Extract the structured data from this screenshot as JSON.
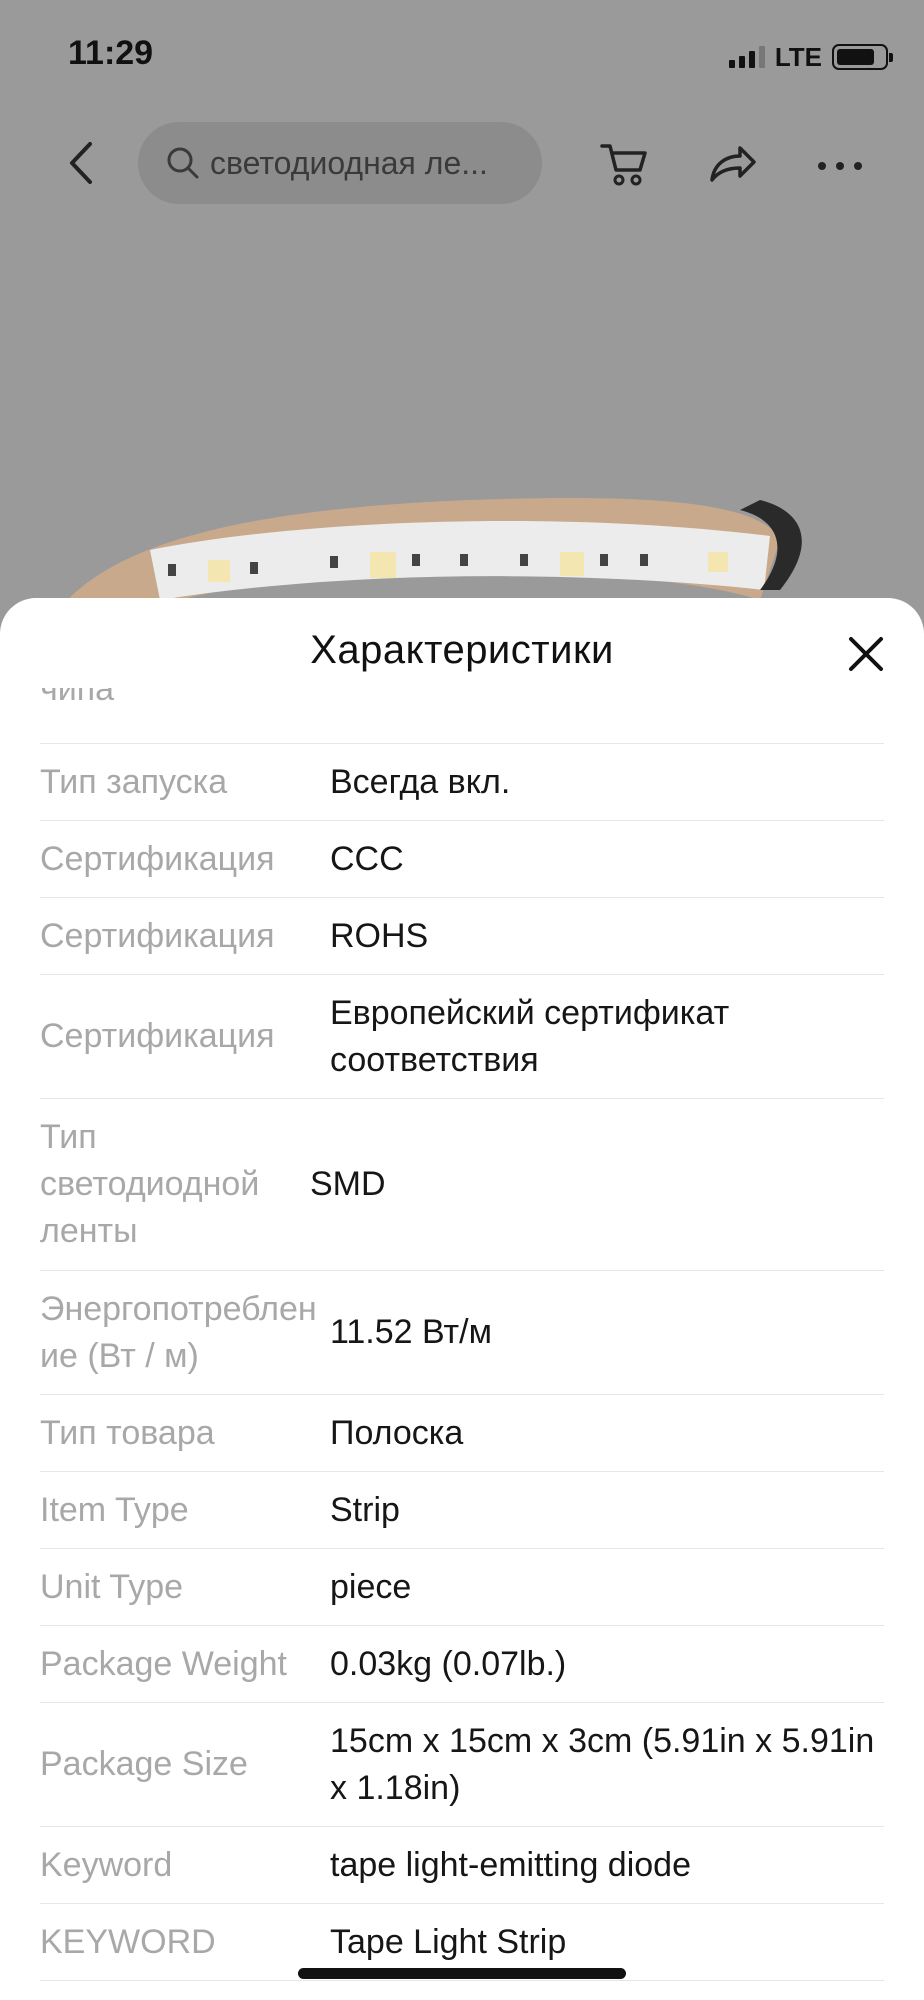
{
  "status_bar": {
    "time": "11:29",
    "network": "LTE"
  },
  "top_nav": {
    "search_text": "светодиодная ле...",
    "icons": [
      "back-icon",
      "search-icon",
      "cart-icon",
      "share-icon",
      "more-icon"
    ]
  },
  "sheet": {
    "title": "Характеристики",
    "partial_label": "чипа",
    "rows": [
      {
        "label": "Тип запуска",
        "value": "Всегда вкл."
      },
      {
        "label": "Сертификация",
        "value": "CCC"
      },
      {
        "label": "Сертификация",
        "value": "ROHS"
      },
      {
        "label": "Сертификация",
        "value": "Европейский сертификат соответствия"
      },
      {
        "label": "Тип светодиодной ленты",
        "value": "SMD"
      },
      {
        "label": "Энергопотребление (Вт / м)",
        "value": "11.52 Вт/м"
      },
      {
        "label": "Тип товара",
        "value": "Полоска"
      },
      {
        "label": "Item Type",
        "value": "Strip"
      },
      {
        "label": "Unit Type",
        "value": "piece"
      },
      {
        "label": "Package Weight",
        "value": "0.03kg (0.07lb.)"
      },
      {
        "label": "Package Size",
        "value": "15cm x 15cm x 3cm (5.91in x 5.91in x 1.18in)"
      },
      {
        "label": "Keyword",
        "value": "tape light-emitting diode"
      },
      {
        "label": "KEYWORD",
        "value": "Tape Light Strip"
      }
    ]
  },
  "colors": {
    "label": "#a8a8a8",
    "value": "#161616",
    "divider": "#e6e6e6",
    "backdrop": "#9a9a9a"
  }
}
